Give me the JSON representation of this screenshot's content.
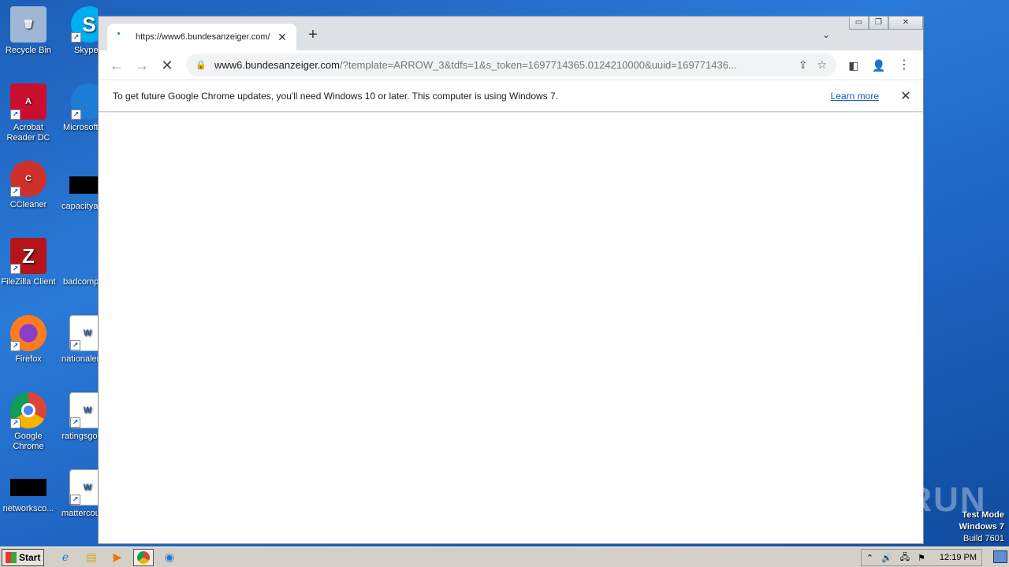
{
  "desktop": {
    "icons_left": [
      {
        "label": "Recycle Bin",
        "icon": "recycle-bin-icon",
        "color": "#9fb7d4"
      },
      {
        "label": "Acrobat Reader DC",
        "icon": "acrobat-icon",
        "color": "#c8102e"
      },
      {
        "label": "CCleaner",
        "icon": "ccleaner-icon",
        "color": "#d0302a"
      },
      {
        "label": "FileZilla Client",
        "icon": "filezilla-icon",
        "color": "#b4141b"
      },
      {
        "label": "Firefox",
        "icon": "firefox-icon",
        "color": "#ff7b1f"
      },
      {
        "label": "Google Chrome",
        "icon": "chrome-icon",
        "color": "#2a8a3e"
      },
      {
        "label": "networksco...",
        "icon": "blank-file-icon",
        "color": "#000000"
      }
    ],
    "icons_right": [
      {
        "label": "Skype",
        "icon": "skype-icon",
        "color": "#00aff0"
      },
      {
        "label": "Microsoft",
        "icon": "edge-icon",
        "color": "#1e7bd6"
      },
      {
        "label": "capacitya",
        "icon": "blank-file-icon",
        "color": "#000000"
      },
      {
        "label": "badcomp",
        "icon": "blank-file-icon",
        "color": "#1f66c4"
      },
      {
        "label": "nationaler",
        "icon": "word-doc-icon",
        "color": "#2b579a"
      },
      {
        "label": "ratingsgo",
        "icon": "word-doc-icon",
        "color": "#2b579a"
      },
      {
        "label": "mattercou",
        "icon": "word-doc-icon",
        "color": "#2b579a"
      }
    ]
  },
  "browser": {
    "tab_title": "https://www6.bundesanzeiger.com/",
    "tab_close": "✕",
    "new_tab": "+",
    "url_host": "www6.bundesanzeiger.com",
    "url_path": "/?template=ARROW_3&tdfs=1&s_token=1697714365.0124210000&uuid=169771436...",
    "window_controls": {
      "minimize": "▭",
      "restore": "❐",
      "close": "✕"
    },
    "infobar": {
      "message": "To get future Google Chrome updates, you'll need Windows 10 or later. This computer is using Windows 7.",
      "learn_more": "Learn more"
    }
  },
  "watermark": {
    "text": "ANY RUN"
  },
  "system": {
    "test_mode": "Test Mode",
    "os": "Windows 7",
    "build": "Build 7601",
    "start": "Start",
    "time": "12:19 PM"
  },
  "colors": {
    "desktop": "#1f66c4",
    "tabstrip": "#dee1e6",
    "omnibox": "#f1f3f4",
    "link": "#1a55c0"
  }
}
